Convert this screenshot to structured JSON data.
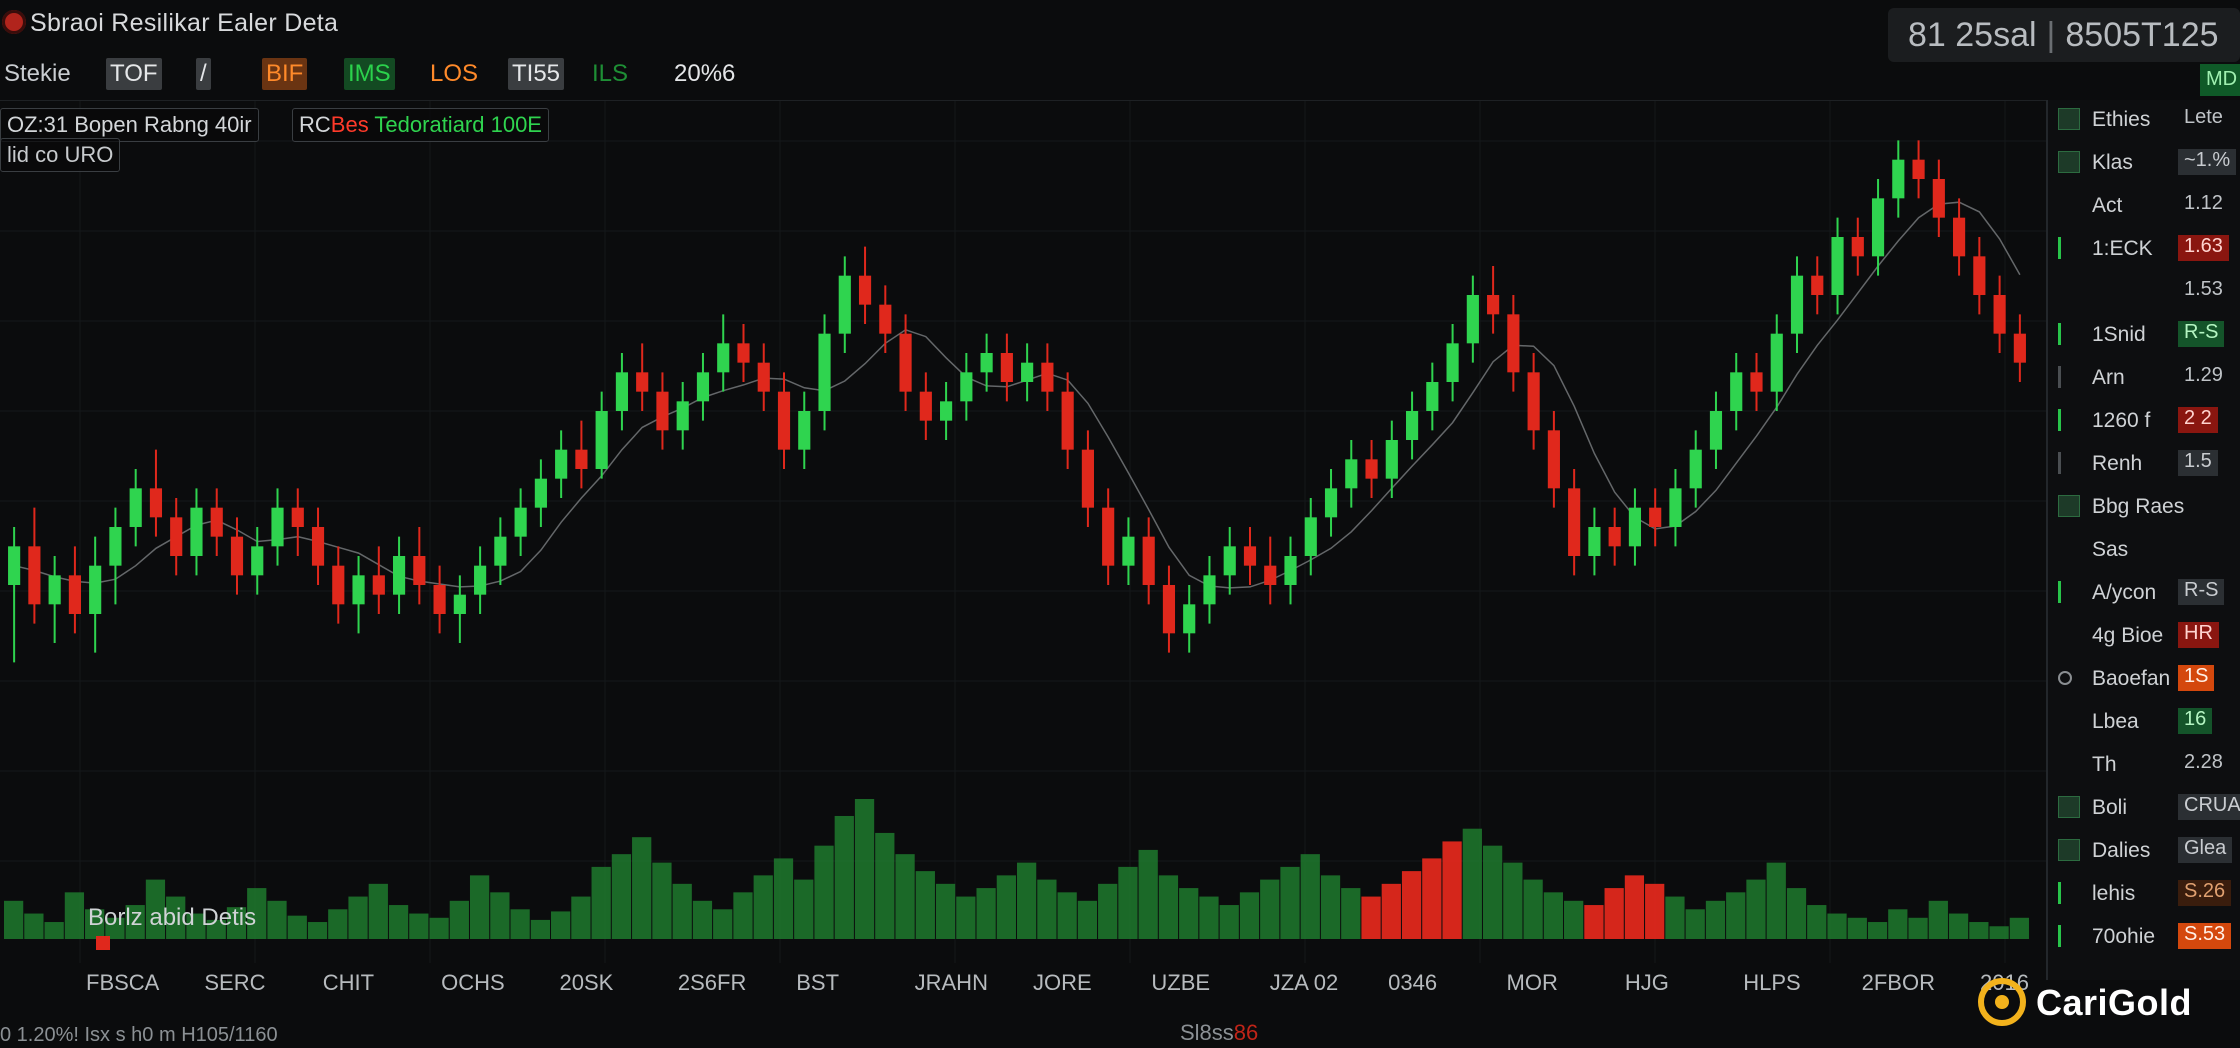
{
  "window": {
    "title": "Sbraoi Resilikar Ealer Deta"
  },
  "top_readout": {
    "left": "81 25sal",
    "right": "8505T125"
  },
  "md_badge": "MD",
  "toolbar": {
    "symbol_label": "Stekie",
    "items": [
      "TOF",
      "/",
      "BIF",
      "IMS",
      "LOS",
      "TI55",
      "ILS",
      "20%6"
    ]
  },
  "legends": {
    "a": "OZ:31 Bopen Rabng 40ir",
    "b_prefix": "RC",
    "b_red": "Bes",
    "b_green": "Tedoratiard 100E",
    "c": "lid co URO"
  },
  "volume": {
    "label": "Borlz abid Detis"
  },
  "x_axis": [
    "FBSCA",
    "SERC",
    "CHIT",
    "OCHS",
    "20SK",
    "2S6FR",
    "BST",
    "JRAHN",
    "JORE",
    "UZBE",
    "JZA 02",
    "0346",
    "MOR",
    "HJG",
    "HLPS",
    "2FBOR",
    "2016"
  ],
  "footer": {
    "left": "0 1.20%! Isx s h0 m H105/1160",
    "mid": "Sl8ss",
    "mid_red": "86"
  },
  "right_panel": [
    {
      "label": "Ethies",
      "value": "Lete",
      "style": "none",
      "ind": "box"
    },
    {
      "label": "Klas",
      "value": "~1.%",
      "style": "gray",
      "ind": "box"
    },
    {
      "label": "Act",
      "value": "1.12",
      "style": "none",
      "ind": ""
    },
    {
      "label": "1:ECK",
      "value": "1.63",
      "style": "red",
      "ind": "green"
    },
    {
      "label": "",
      "value": "1.53",
      "style": "none",
      "ind": ""
    },
    {
      "label": "1Snid",
      "value": "R-S",
      "style": "green",
      "ind": "green"
    },
    {
      "label": "Arn",
      "value": "1.29",
      "style": "none",
      "ind": "gray"
    },
    {
      "label": "1260 f",
      "value": "2 2",
      "style": "red",
      "ind": "green"
    },
    {
      "label": "Renh",
      "value": "1.5",
      "style": "gray",
      "ind": "gray"
    },
    {
      "label": "Bbg Raes",
      "value": "",
      "style": "none",
      "ind": "box"
    },
    {
      "label": "Sas",
      "value": "",
      "style": "none",
      "ind": ""
    },
    {
      "label": "A/ycon",
      "value": "R-S",
      "style": "gray",
      "ind": "green"
    },
    {
      "label": "4g Bioe",
      "value": "HR",
      "style": "red",
      "ind": ""
    },
    {
      "label": "Baoefan",
      "value": "1S",
      "style": "orange",
      "ind": "dot"
    },
    {
      "label": "Lbea",
      "value": "16",
      "style": "green",
      "ind": ""
    },
    {
      "label": "Th",
      "value": "2.28",
      "style": "none",
      "ind": ""
    },
    {
      "label": "Boli",
      "value": "CRUA",
      "style": "gray",
      "ind": "box"
    },
    {
      "label": "Dalies",
      "value": "Glea",
      "style": "gray",
      "ind": "box"
    },
    {
      "label": "lehis",
      "value": "S.26",
      "style": "brown",
      "ind": "green"
    },
    {
      "label": "70ohie",
      "value": "S.53",
      "style": "orange",
      "ind": "green"
    }
  ],
  "logo": {
    "text": "CariGold"
  },
  "colors": {
    "up": "#2fd44f",
    "down": "#e0281c",
    "volume": "#1f7a2e",
    "background": "#0b0c0d"
  },
  "chart_data": {
    "type": "candlestick",
    "candles": [
      [
        52,
        56,
        44,
        58
      ],
      [
        56,
        50,
        48,
        60
      ],
      [
        50,
        53,
        46,
        55
      ],
      [
        53,
        49,
        47,
        56
      ],
      [
        49,
        54,
        45,
        57
      ],
      [
        54,
        58,
        50,
        60
      ],
      [
        58,
        62,
        56,
        64
      ],
      [
        62,
        59,
        57,
        66
      ],
      [
        59,
        55,
        53,
        61
      ],
      [
        55,
        60,
        53,
        62
      ],
      [
        60,
        57,
        55,
        62
      ],
      [
        57,
        53,
        51,
        59
      ],
      [
        53,
        56,
        51,
        58
      ],
      [
        56,
        60,
        54,
        62
      ],
      [
        60,
        58,
        55,
        62
      ],
      [
        58,
        54,
        52,
        60
      ],
      [
        54,
        50,
        48,
        56
      ],
      [
        50,
        53,
        47,
        55
      ],
      [
        53,
        51,
        49,
        56
      ],
      [
        51,
        55,
        49,
        57
      ],
      [
        55,
        52,
        50,
        58
      ],
      [
        52,
        49,
        47,
        54
      ],
      [
        49,
        51,
        46,
        53
      ],
      [
        51,
        54,
        49,
        56
      ],
      [
        54,
        57,
        52,
        59
      ],
      [
        57,
        60,
        55,
        62
      ],
      [
        60,
        63,
        58,
        65
      ],
      [
        63,
        66,
        61,
        68
      ],
      [
        66,
        64,
        62,
        69
      ],
      [
        64,
        70,
        63,
        72
      ],
      [
        70,
        74,
        68,
        76
      ],
      [
        74,
        72,
        70,
        77
      ],
      [
        72,
        68,
        66,
        74
      ],
      [
        68,
        71,
        66,
        73
      ],
      [
        71,
        74,
        69,
        76
      ],
      [
        74,
        77,
        72,
        80
      ],
      [
        77,
        75,
        73,
        79
      ],
      [
        75,
        72,
        70,
        77
      ],
      [
        72,
        66,
        64,
        74
      ],
      [
        66,
        70,
        64,
        72
      ],
      [
        70,
        78,
        68,
        80
      ],
      [
        78,
        84,
        76,
        86
      ],
      [
        84,
        81,
        79,
        87
      ],
      [
        81,
        78,
        76,
        83
      ],
      [
        78,
        72,
        70,
        80
      ],
      [
        72,
        69,
        67,
        74
      ],
      [
        69,
        71,
        67,
        73
      ],
      [
        71,
        74,
        69,
        76
      ],
      [
        74,
        76,
        72,
        78
      ],
      [
        76,
        73,
        71,
        78
      ],
      [
        73,
        75,
        71,
        77
      ],
      [
        75,
        72,
        70,
        77
      ],
      [
        72,
        66,
        64,
        74
      ],
      [
        66,
        60,
        58,
        68
      ],
      [
        60,
        54,
        52,
        62
      ],
      [
        54,
        57,
        52,
        59
      ],
      [
        57,
        52,
        50,
        59
      ],
      [
        52,
        47,
        45,
        54
      ],
      [
        47,
        50,
        45,
        52
      ],
      [
        50,
        53,
        48,
        55
      ],
      [
        53,
        56,
        51,
        58
      ],
      [
        56,
        54,
        52,
        58
      ],
      [
        54,
        52,
        50,
        57
      ],
      [
        52,
        55,
        50,
        57
      ],
      [
        55,
        59,
        53,
        61
      ],
      [
        59,
        62,
        57,
        64
      ],
      [
        62,
        65,
        60,
        67
      ],
      [
        65,
        63,
        61,
        67
      ],
      [
        63,
        67,
        61,
        69
      ],
      [
        67,
        70,
        65,
        72
      ],
      [
        70,
        73,
        68,
        75
      ],
      [
        73,
        77,
        71,
        79
      ],
      [
        77,
        82,
        75,
        84
      ],
      [
        82,
        80,
        78,
        85
      ],
      [
        80,
        74,
        72,
        82
      ],
      [
        74,
        68,
        66,
        76
      ],
      [
        68,
        62,
        60,
        70
      ],
      [
        62,
        55,
        53,
        64
      ],
      [
        55,
        58,
        53,
        60
      ],
      [
        58,
        56,
        54,
        60
      ],
      [
        56,
        60,
        54,
        62
      ],
      [
        60,
        58,
        56,
        62
      ],
      [
        58,
        62,
        56,
        64
      ],
      [
        62,
        66,
        60,
        68
      ],
      [
        66,
        70,
        64,
        72
      ],
      [
        70,
        74,
        68,
        76
      ],
      [
        74,
        72,
        70,
        76
      ],
      [
        72,
        78,
        70,
        80
      ],
      [
        78,
        84,
        76,
        86
      ],
      [
        84,
        82,
        80,
        86
      ],
      [
        82,
        88,
        80,
        90
      ],
      [
        88,
        86,
        84,
        90
      ],
      [
        86,
        92,
        84,
        94
      ],
      [
        92,
        96,
        90,
        98
      ],
      [
        96,
        94,
        92,
        98
      ],
      [
        94,
        90,
        88,
        96
      ],
      [
        90,
        86,
        84,
        92
      ],
      [
        86,
        82,
        80,
        88
      ],
      [
        82,
        78,
        76,
        84
      ],
      [
        78,
        75,
        73,
        80
      ]
    ],
    "volume": [
      18,
      12,
      8,
      22,
      14,
      10,
      16,
      28,
      20,
      12,
      9,
      15,
      24,
      18,
      11,
      8,
      14,
      20,
      26,
      16,
      12,
      10,
      18,
      30,
      22,
      14,
      9,
      13,
      20,
      34,
      40,
      48,
      36,
      26,
      18,
      14,
      22,
      30,
      38,
      28,
      44,
      58,
      66,
      50,
      40,
      32,
      26,
      20,
      24,
      30,
      36,
      28,
      22,
      18,
      26,
      34,
      42,
      30,
      24,
      20,
      16,
      22,
      28,
      34,
      40,
      30,
      24,
      20,
      26,
      32,
      38,
      46,
      52,
      44,
      36,
      28,
      22,
      18,
      16,
      24,
      30,
      26,
      20,
      14,
      18,
      22,
      28,
      36,
      24,
      16,
      12,
      10,
      8,
      14,
      10,
      18,
      12,
      8,
      6,
      10
    ],
    "volume_down_indices": [
      67,
      68,
      69,
      70,
      71,
      78,
      79,
      80,
      81
    ],
    "ylim": [
      40,
      100
    ],
    "grid": true
  }
}
